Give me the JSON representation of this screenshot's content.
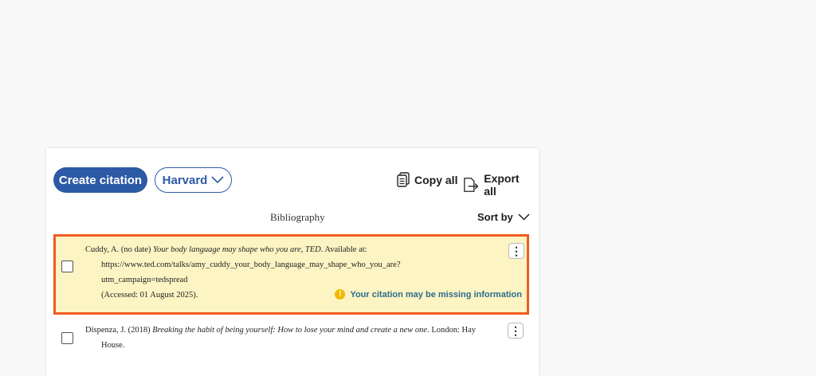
{
  "toolbar": {
    "create_label": "Create citation",
    "style_label": "Harvard",
    "copy_all_label": "Copy all",
    "export_all_label": "Export all"
  },
  "list": {
    "title": "Bibliography",
    "sort_label": "Sort by"
  },
  "entries": [
    {
      "author_date": "Cuddy, A. (no date) ",
      "title": "Your body language may shape who you are, TED",
      "rest": ". Available at:",
      "url": "https://www.ted.com/talks/amy_cuddy_your_body_language_may_shape_who_you_are?utm_campaign=tedspread",
      "accessed": "(Accessed: 01 August 2025).",
      "warning": "Your citation may be missing information",
      "highlighted": true
    },
    {
      "author_date": "Dispenza, J. (2018) ",
      "title": "Breaking the habit of being yourself: How to lose your mind and create a new one",
      "rest": ". London: Hay",
      "cont": "House.",
      "highlighted": false
    }
  ],
  "colors": {
    "accent": "#2d5aa5",
    "highlight_bg": "#fcf4c3",
    "highlight_border": "#f15a22",
    "warning_icon": "#f2b600",
    "warning_text": "#2d6d8e"
  }
}
